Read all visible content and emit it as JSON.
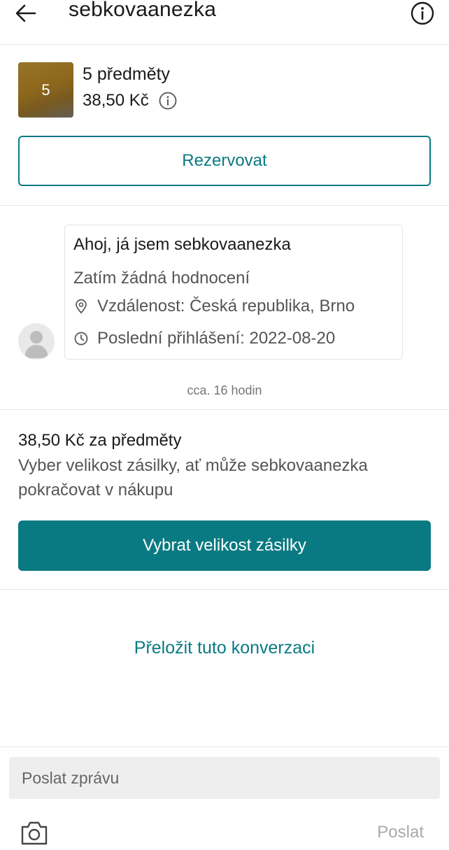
{
  "header": {
    "title": "sebkovaanezka",
    "back_icon": "arrow-left-icon",
    "info_icon": "info-circle-icon"
  },
  "items": {
    "thumbnail_count": "5",
    "count_label": "5 předměty",
    "price": "38,50 Kč",
    "price_info_icon": "info-circle-icon",
    "reserve_label": "Rezervovat"
  },
  "profile": {
    "greeting": "Ahoj, já jsem sebkovaanezka",
    "rating": "Zatím žádná hodnocení",
    "location": "Vzdálenost: Česká republika, Brno",
    "last_login": "Poslední přihlášení: 2022-08-20",
    "time_ago": "cca. 16 hodin"
  },
  "shipping": {
    "heading": "38,50 Kč za předměty",
    "description": "Vyber velikost zásilky, ať může sebkovaanezka pokračovat v nákupu",
    "button_label": "Vybrat velikost zásilky"
  },
  "translate": {
    "label": "Přeložit tuto konverzaci"
  },
  "composer": {
    "placeholder": "Poslat zprávu",
    "send_label": "Poslat",
    "camera_icon": "camera-icon"
  },
  "colors": {
    "accent": "#0a7a82",
    "divider": "#e6e6e6",
    "input_bg": "#eeeeee"
  }
}
